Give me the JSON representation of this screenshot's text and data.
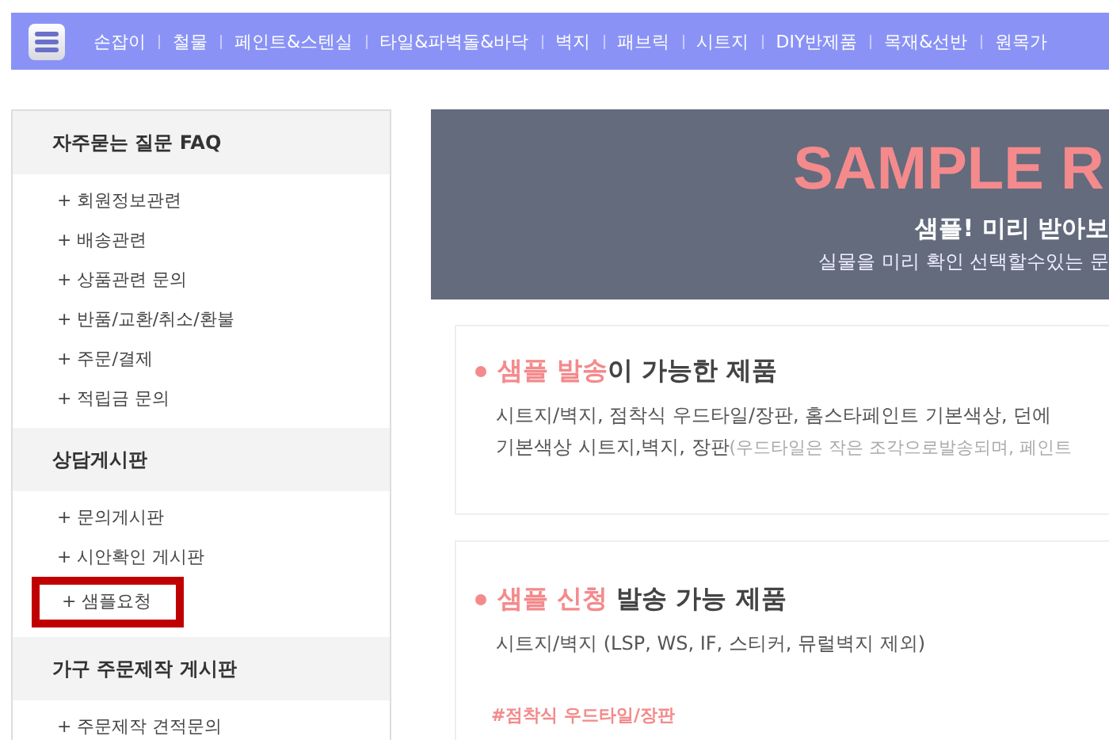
{
  "nav": {
    "items": [
      "손잡이",
      "철물",
      "페인트&스텐실",
      "타일&파벽돌&바닥",
      "벽지",
      "패브릭",
      "시트지",
      "DIY반제품",
      "목재&선반",
      "원목가"
    ]
  },
  "sidebar": {
    "sections": [
      {
        "title": "자주묻는 질문 FAQ",
        "items": [
          {
            "label": "+ 회원정보관련",
            "highlighted": false
          },
          {
            "label": "+ 배송관련",
            "highlighted": false
          },
          {
            "label": "+ 상품관련 문의",
            "highlighted": false
          },
          {
            "label": "+ 반품/교환/취소/환불",
            "highlighted": false
          },
          {
            "label": "+ 주문/결제",
            "highlighted": false
          },
          {
            "label": "+ 적립금 문의",
            "highlighted": false
          }
        ]
      },
      {
        "title": "상담게시판",
        "items": [
          {
            "label": "+ 문의게시판",
            "highlighted": false
          },
          {
            "label": "+ 시안확인 게시판",
            "highlighted": false
          },
          {
            "label": "+ 샘플요청",
            "highlighted": true
          }
        ]
      },
      {
        "title": "가구 주문제작 게시판",
        "items": [
          {
            "label": "+ 주문제작 견적문의",
            "highlighted": false
          }
        ]
      }
    ]
  },
  "banner": {
    "title": "SAMPLE R",
    "subtitle": "샘플! 미리 받아보",
    "caption": "실물을 미리 확인 선택할수있는 문"
  },
  "cards": [
    {
      "heading_highlight": "샘플 발송",
      "heading_rest": "이 가능한 제품",
      "lines": [
        {
          "text": "시트지/벽지, 점착식 우드타일/장판, 홈스타페인트 기본색상, 던에"
        },
        {
          "text": "기본색상 시트지,벽지, 장판",
          "note": "(우드타일은 작은 조각으로발송되며, 페인트"
        }
      ]
    },
    {
      "heading_highlight": "샘플 신청",
      "heading_rest": " 발송 가능 제품",
      "lines": [
        {
          "text": "시트지/벽지 (LSP, WS, IF, 스티커, 뮤럴벽지 제외)"
        }
      ],
      "tag": "#점착식 우드타일/장판"
    }
  ]
}
